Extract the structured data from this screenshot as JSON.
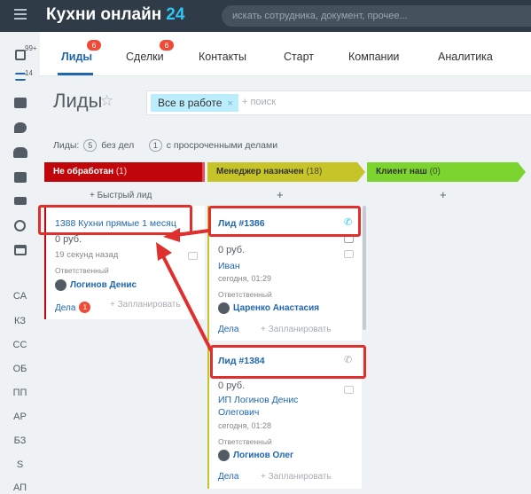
{
  "header": {
    "logo_text": "Кухни онлайн",
    "logo_number": "24",
    "search_placeholder": "искать сотрудника, документ, прочее..."
  },
  "sidebar": {
    "badges": [
      "99+",
      "14"
    ],
    "icons": [
      "check-icon",
      "filter-icon",
      "tasks-icon",
      "chat-icon",
      "group-icon",
      "calendar-icon",
      "drive-icon",
      "clock-icon",
      "window-icon"
    ],
    "text_items": [
      "CA",
      "КЗ",
      "CC",
      "ОБ",
      "ПП",
      "AP",
      "БЗ",
      "S",
      "АП"
    ]
  },
  "tabs": [
    {
      "label": "Лиды",
      "badge": "6",
      "active": true
    },
    {
      "label": "Сделки",
      "badge": "6",
      "active": false
    },
    {
      "label": "Контакты",
      "active": false
    },
    {
      "label": "Старт",
      "active": false
    },
    {
      "label": "Компании",
      "active": false
    },
    {
      "label": "Аналитика",
      "active": false
    }
  ],
  "page": {
    "title": "Лиды",
    "filter_chip": "Все в работе",
    "search_plus": "+ поиск"
  },
  "stats": {
    "label": "Лиды:",
    "without_deals_count": "5",
    "without_deals_text": "без дел",
    "overdue_count": "1",
    "overdue_text": "с просроченными делами"
  },
  "columns": [
    {
      "title": "Не обработан",
      "count": "(1)",
      "color": "#c1060b",
      "text_color": "#ffffff",
      "add_label": "+ Быстрый лид"
    },
    {
      "title": "Менеджер назначен",
      "count": "(18)",
      "color": "#c7c42a",
      "text_color": "#333333",
      "add_label": "+"
    },
    {
      "title": "Клиент наш",
      "count": "(0)",
      "color": "#7bd52e",
      "text_color": "#333333",
      "add_label": "+"
    }
  ],
  "cards": {
    "lead_1388": {
      "title": "1388 Кухни прямые 1 месяц",
      "amount": "0 руб.",
      "time": "19 секунд назад",
      "responsible_label": "Ответственный",
      "responsible": "Логинов Денис",
      "deals_label": "Дела",
      "deals_badge": "1",
      "plan_label": "+ Запланировать"
    },
    "lead_1386": {
      "title": "Лид #1386",
      "amount": "0 руб.",
      "contact": "Иван",
      "time": "сегодня, 01:29",
      "responsible_label": "Ответственный",
      "responsible": "Царенко Анастасия",
      "deals_label": "Дела",
      "plan_label": "+ Запланировать"
    },
    "lead_1384": {
      "title": "Лид #1384",
      "amount": "0 руб.",
      "contact_line1": "ИП Логинов Денис",
      "contact_line2": "Олегович",
      "time": "сегодня, 01:28",
      "responsible_label": "Ответственный",
      "responsible": "Логинов Олег",
      "deals_label": "Дела",
      "plan_label": "+ Запланировать"
    }
  },
  "annotation_color": "#e0302e"
}
